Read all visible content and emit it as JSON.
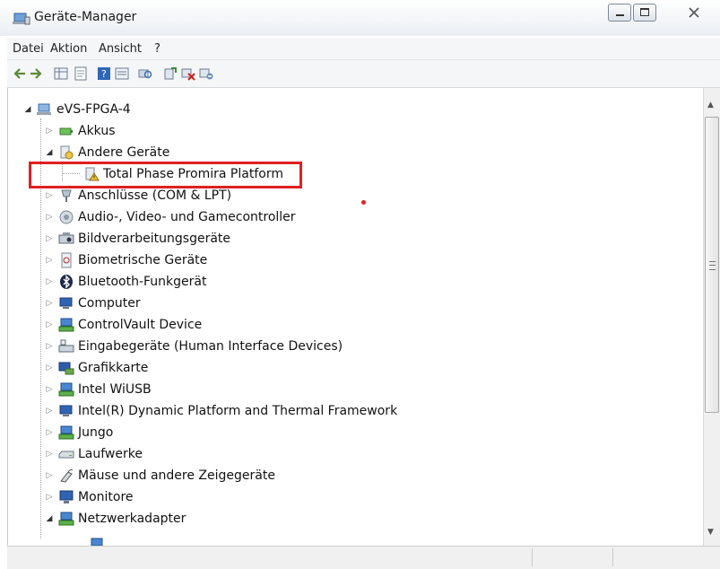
{
  "window": {
    "title": "Geräte-Manager"
  },
  "menu": [
    "Datei",
    "Aktion",
    "Ansicht",
    "?"
  ],
  "toolbar_icons": [
    "back-arrow-icon",
    "forward-arrow-icon",
    "grid-view-icon",
    "properties-icon",
    "help-icon",
    "list-view-icon",
    "scan-hardware-icon",
    "update-driver-icon",
    "uninstall-driver-icon",
    "disable-device-icon"
  ],
  "tree": {
    "root": "eVS-FPGA-4",
    "items": [
      {
        "label": "Akkus",
        "icon": "battery-icon",
        "expanded": false
      },
      {
        "label": "Andere Geräte",
        "icon": "unknown-device-icon",
        "expanded": true
      },
      {
        "label": "Total Phase Promira Platform",
        "icon": "warning-device-icon",
        "child": true
      },
      {
        "label": "Anschlüsse (COM & LPT)",
        "icon": "port-icon",
        "expanded": false
      },
      {
        "label": "Audio-, Video- und Gamecontroller",
        "icon": "speaker-icon",
        "expanded": false
      },
      {
        "label": "Bildverarbeitungsgeräte",
        "icon": "camera-icon",
        "expanded": false
      },
      {
        "label": "Biometrische Geräte",
        "icon": "fingerprint-icon",
        "expanded": false
      },
      {
        "label": "Bluetooth-Funkgerät",
        "icon": "bluetooth-icon",
        "expanded": false
      },
      {
        "label": "Computer",
        "icon": "computer-icon",
        "expanded": false
      },
      {
        "label": "ControlVault Device",
        "icon": "network-device-icon",
        "expanded": false
      },
      {
        "label": "Eingabegeräte (Human Interface Devices)",
        "icon": "keyboard-icon",
        "expanded": false
      },
      {
        "label": "Grafikkarte",
        "icon": "display-adapter-icon",
        "expanded": false
      },
      {
        "label": "Intel WiUSB",
        "icon": "network-device-icon",
        "expanded": false
      },
      {
        "label": "Intel(R) Dynamic Platform and Thermal Framework",
        "icon": "computer-icon",
        "expanded": false
      },
      {
        "label": "Jungo",
        "icon": "network-device-icon",
        "expanded": false
      },
      {
        "label": "Laufwerke",
        "icon": "disk-drive-icon",
        "expanded": false
      },
      {
        "label": "Mäuse und andere Zeigegeräte",
        "icon": "mouse-icon",
        "expanded": false
      },
      {
        "label": "Monitore",
        "icon": "monitor-icon",
        "expanded": false
      },
      {
        "label": "Netzwerkadapter",
        "icon": "network-adapter-icon",
        "expanded": true
      }
    ]
  },
  "colors": {
    "highlight": "#e02020"
  }
}
